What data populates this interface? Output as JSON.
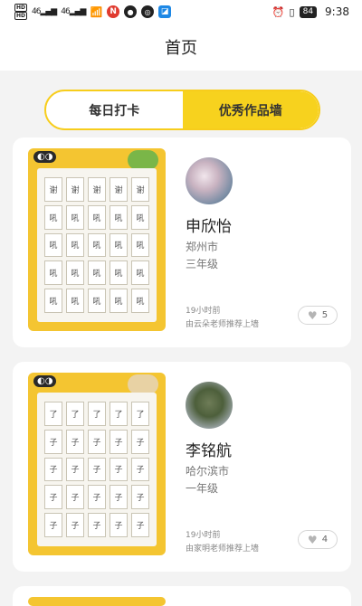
{
  "status_bar": {
    "left": [
      "HD",
      "46",
      "46"
    ],
    "battery": "84",
    "time": "9:38"
  },
  "header": {
    "title": "首页"
  },
  "tabs": [
    {
      "label": "每日打卡",
      "active": false
    },
    {
      "label": "优秀作品墙",
      "active": true
    }
  ],
  "cards": [
    {
      "name": "申欣怡",
      "city": "郑州市",
      "grade": "三年级",
      "time": "19小时前",
      "recommend": "由云朵老师推荐上墙",
      "likes": "5",
      "sheet_chars": [
        "谢",
        "谢",
        "谢",
        "谢",
        "谢",
        "吼",
        "吼",
        "吼",
        "吼",
        "吼",
        "吼",
        "吼",
        "吼",
        "吼",
        "吼",
        "吼",
        "吼",
        "吼",
        "吼",
        "吼",
        "吼",
        "吼",
        "吼",
        "吼",
        "吼"
      ]
    },
    {
      "name": "李铭航",
      "city": "哈尔滨市",
      "grade": "一年级",
      "time": "19小时前",
      "recommend": "由家明老师推荐上墙",
      "likes": "4",
      "sheet_chars": [
        "了",
        "了",
        "了",
        "了",
        "了",
        "子",
        "子",
        "子",
        "子",
        "子",
        "子",
        "子",
        "子",
        "子",
        "子",
        "子",
        "子",
        "子",
        "子",
        "子",
        "子",
        "子",
        "子",
        "子",
        "子"
      ]
    }
  ],
  "icons": {
    "like": "heart-icon"
  }
}
